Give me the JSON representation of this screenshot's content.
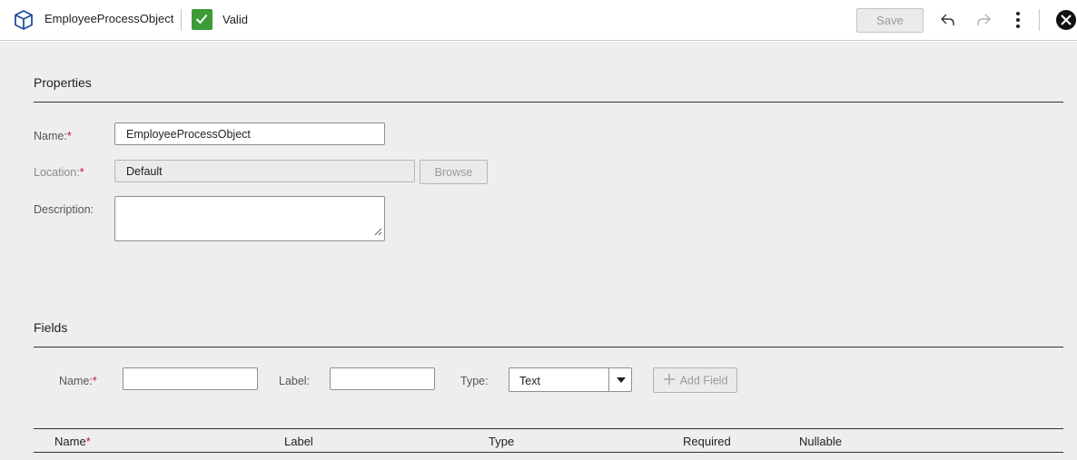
{
  "header": {
    "object_name": "EmployeeProcessObject",
    "status_label": "Valid",
    "save_label": "Save",
    "icons": [
      "process-object-icon",
      "check-icon",
      "undo-icon",
      "redo-icon",
      "more-vertical-icon",
      "close-icon"
    ],
    "status_color": "#3d9b35"
  },
  "properties": {
    "title": "Properties",
    "name": {
      "label": "Name:",
      "required_mark": "*",
      "value": "EmployeeProcessObject"
    },
    "location": {
      "label": "Location:",
      "required_mark": "*",
      "value": "Default",
      "browse_label": "Browse"
    },
    "description": {
      "label": "Description:",
      "value": ""
    }
  },
  "fields": {
    "title": "Fields",
    "name": {
      "label": "Name:",
      "required_mark": "*",
      "value": ""
    },
    "label": {
      "label": "Label:",
      "value": ""
    },
    "type": {
      "label": "Type:",
      "selected": "Text"
    },
    "add_field_label": "Add Field",
    "columns": {
      "name": "Name",
      "name_required_mark": "*",
      "label": "Label",
      "type": "Type",
      "required": "Required",
      "nullable": "Nullable"
    }
  }
}
